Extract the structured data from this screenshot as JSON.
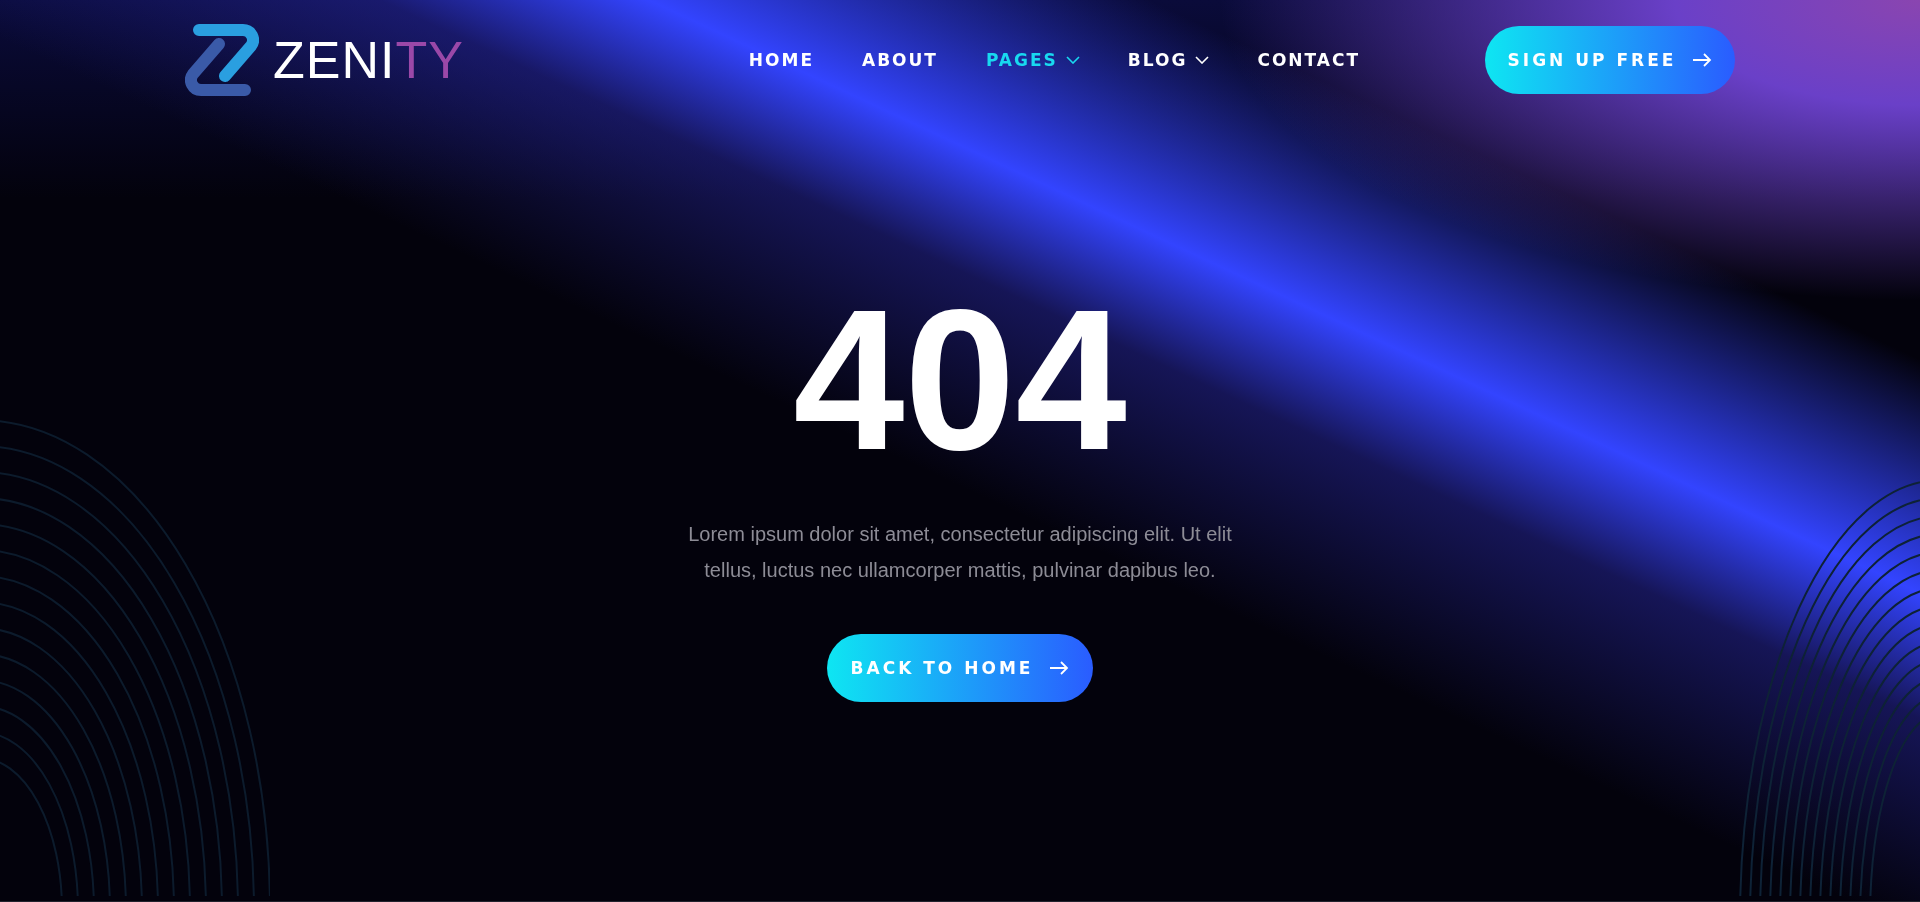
{
  "logo": {
    "text": "ZENI",
    "accent": "TY"
  },
  "nav": [
    {
      "label": "HOME",
      "selected": false,
      "dropdown": false
    },
    {
      "label": "ABOUT",
      "selected": false,
      "dropdown": false
    },
    {
      "label": "PAGES",
      "selected": true,
      "dropdown": true
    },
    {
      "label": "BLOG",
      "selected": false,
      "dropdown": true
    },
    {
      "label": "CONTACT",
      "selected": false,
      "dropdown": false
    }
  ],
  "signup_button": {
    "label": "SIGN UP FREE"
  },
  "error": {
    "code": "404",
    "message": "Lorem ipsum dolor sit amet, consectetur adipiscing elit. Ut elit tellus, luctus nec ullamcorper mattis, pulvinar dapibus leo."
  },
  "back_button": {
    "label": "BACK TO HOME"
  }
}
